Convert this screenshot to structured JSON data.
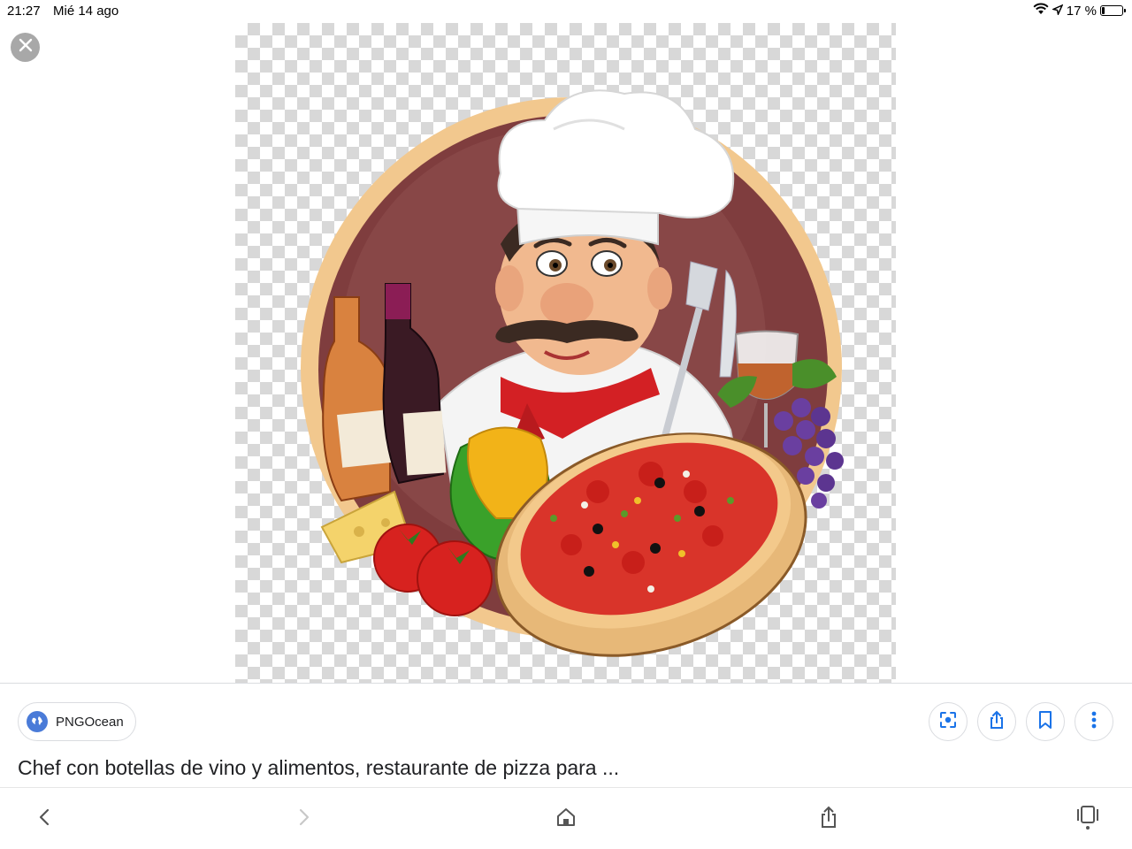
{
  "status_bar": {
    "time": "21:27",
    "date": "Mié 14 ago",
    "battery_text": "17 %",
    "battery_level": 0.17,
    "icons": [
      "wifi-icon",
      "location-icon",
      "battery-icon"
    ]
  },
  "viewer": {
    "close_icon": "close-icon",
    "image_subject": "chef-pizza-wine-illustration"
  },
  "source": {
    "icon": "globe-icon",
    "name": "PNGOcean"
  },
  "actions": [
    "lens-icon",
    "share-icon",
    "bookmark-icon",
    "more-vert-icon"
  ],
  "caption": "Chef con botellas de vino y alimentos, restaurante de pizza para ...",
  "bottom_nav": [
    "back-icon",
    "forward-icon",
    "home-icon",
    "share-icon",
    "tabs-icon"
  ],
  "colors": {
    "accent": "#1a73e8",
    "globe": "#4a7bd8",
    "close_bg": "#a8a8a8"
  }
}
